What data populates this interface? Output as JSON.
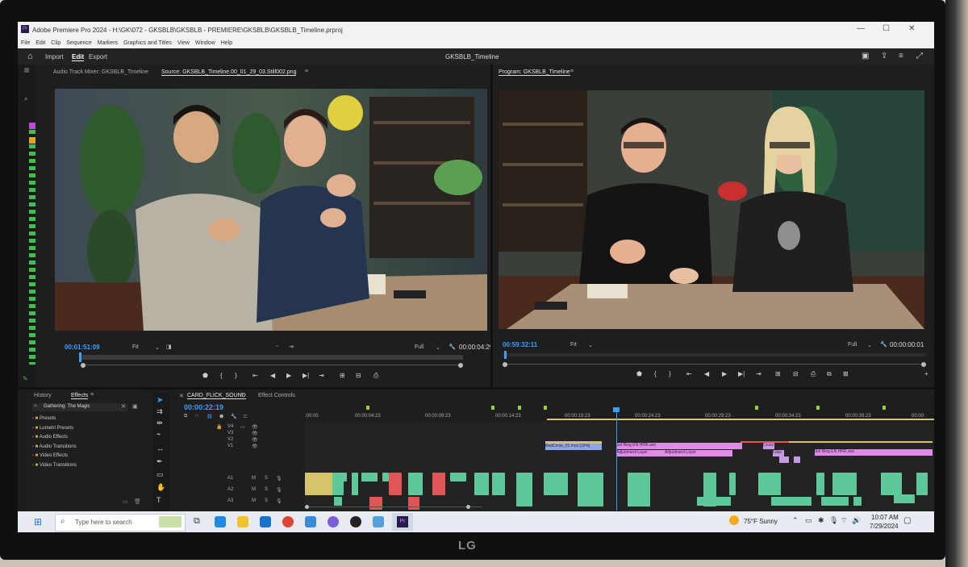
{
  "window": {
    "title": "Adobe Premiere Pro 2024 - H:\\GK\\072 - GKSBLB\\GKSBLB - PREMIERE\\GKSBLB\\GKSBLB_Timeline.prproj",
    "menus": [
      "File",
      "Edit",
      "Clip",
      "Sequence",
      "Markers",
      "Graphics and Titles",
      "View",
      "Window",
      "Help"
    ]
  },
  "header": {
    "workspaces": [
      "Import",
      "Edit",
      "Export"
    ],
    "active_workspace": "Edit",
    "project_title": "GKSBLB_Timeline"
  },
  "source_panel": {
    "tab_mixer": "Audio Track Mixer: GKSBLB_Timeline",
    "tab_source": "Source: GKSBLB_Timeline.00_01_29_03.Still002.png",
    "current_time": "00:01:51:09",
    "zoom": "Fit",
    "resolution": "Full",
    "duration": "00:00:04:29"
  },
  "program_panel": {
    "tab": "Program: GKSBLB_Timeline",
    "current_time": "00:59:32:11",
    "zoom": "Fit",
    "resolution": "Full",
    "duration": "00:00:00:01"
  },
  "effects_panel": {
    "tab_history": "History",
    "tab_effects": "Effects",
    "search": "Gathering: The Magic",
    "items": [
      "Presets",
      "Lumetri Presets",
      "Audio Effects",
      "Audio Transitions",
      "Video Effects",
      "Video Transitions"
    ]
  },
  "timeline": {
    "tab": "CARD_FLICK_SOUND",
    "tab2": "Effect Controls",
    "timecode": "00:00:22:19",
    "ruler": [
      ":00:00",
      "00:00:04:23",
      "00:00:09:23",
      "00:00:14:23",
      "00:00:19:23",
      "00:00:24:23",
      "00:00:29:23",
      "00:00:34:23",
      "00:00:39:23",
      "00:00:"
    ],
    "video_tracks": [
      "V4",
      "V3",
      "V2",
      "V1"
    ],
    "audio_tracks": [
      "A1",
      "A2",
      "A3",
      "A4"
    ],
    "clip_labels": [
      "RedCircle_01.mov [10%]",
      "Sol Ring EN HRR.ane",
      "Adjustment Layer",
      "Adjustment Layer",
      "Sol Ring EN HRR.ane",
      "Fake",
      "Cross"
    ]
  },
  "taskbar": {
    "search_placeholder": "Type here to search",
    "weather": "75°F  Sunny",
    "time": "10:07 AM",
    "date": "7/29/2024"
  },
  "monitor": {
    "brand": "LG"
  }
}
